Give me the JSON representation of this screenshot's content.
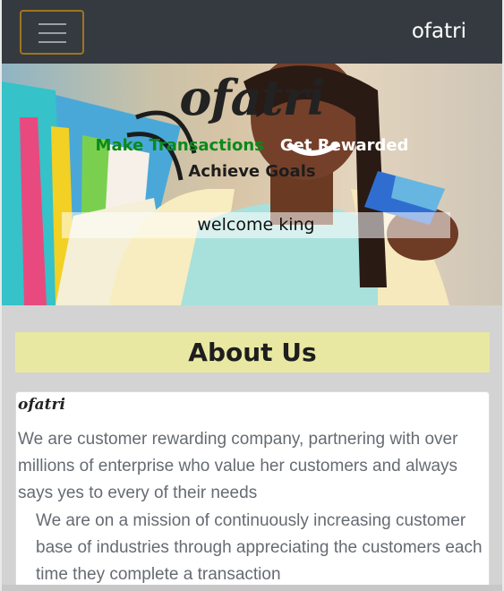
{
  "navbar": {
    "brand": "ofatri",
    "toggler_icon": "hamburger-menu-icon"
  },
  "hero": {
    "logo": "ofatri",
    "tagline_green": "Make Transactions",
    "tagline_white": "Get Rewarded",
    "tagline_dark": "Achieve Goals",
    "welcome": "welcome king"
  },
  "about": {
    "title": "About Us",
    "card_title": "ofatri",
    "paragraph1": "We are customer rewarding company, partnering with over millions of enterprise who value her customers and always says yes to every of their needs",
    "paragraph2": "We are on a mission of continuously increasing customer base of industries through appreciating the customers each time they complete a transaction"
  },
  "colors": {
    "navbar_bg": "#343a40",
    "toggler_border": "#a0741f",
    "about_title_bg": "#e8e8a2",
    "tagline_green": "#0b8a1a",
    "page_bg": "#d3d3d3"
  }
}
